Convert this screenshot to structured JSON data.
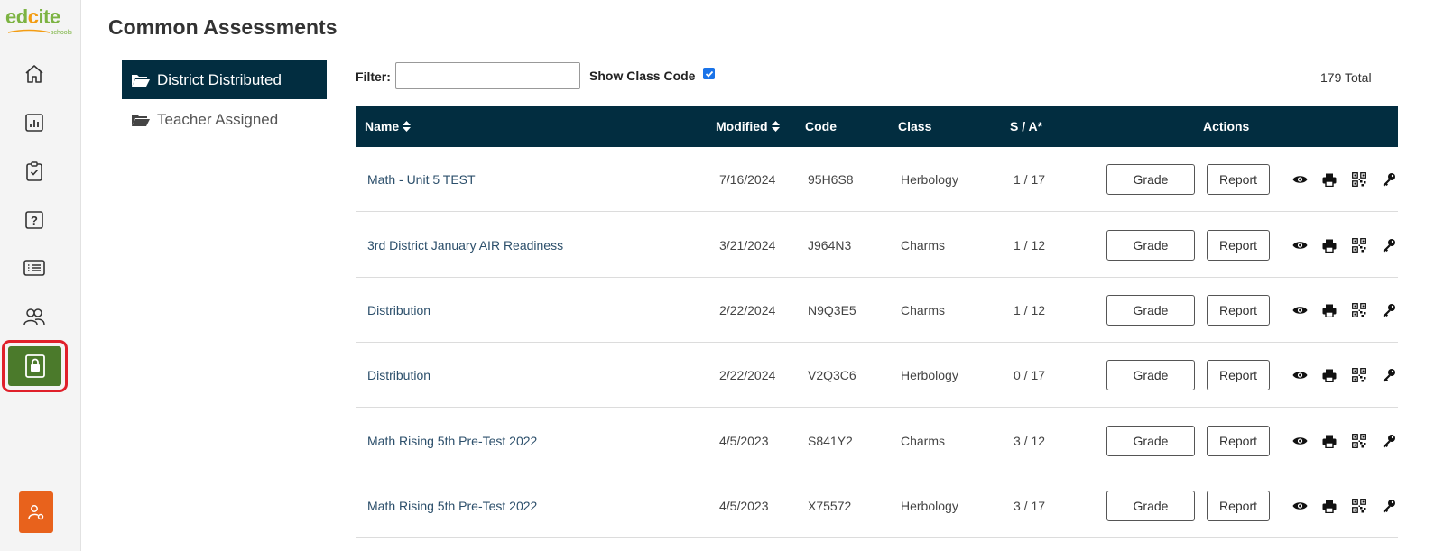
{
  "app": {
    "logo_text": "edcite",
    "logo_sub": "schools",
    "page_title": "Common Assessments"
  },
  "sidebar": {
    "items": [
      {
        "icon": "home-icon"
      },
      {
        "icon": "chart-icon"
      },
      {
        "icon": "clipboard-check-icon"
      },
      {
        "icon": "question-icon"
      },
      {
        "icon": "list-icon"
      },
      {
        "icon": "users-icon"
      },
      {
        "icon": "lock-icon",
        "active": true
      }
    ],
    "user_icon": "user-settings-icon"
  },
  "folders": [
    {
      "label": "District Distributed",
      "active": true
    },
    {
      "label": "Teacher Assigned",
      "active": false
    }
  ],
  "toolbar": {
    "filter_label": "Filter:",
    "filter_value": "",
    "show_class_code_label": "Show Class Code",
    "show_class_code_checked": true,
    "total": "179 Total"
  },
  "table": {
    "headers": {
      "name": "Name",
      "modified": "Modified",
      "code": "Code",
      "class": "Class",
      "sa": "S / A*",
      "actions": "Actions"
    },
    "grade_label": "Grade",
    "report_label": "Report",
    "rows": [
      {
        "name": "Math - Unit 5 TEST",
        "modified": "7/16/2024",
        "code": "95H6S8",
        "class": "Herbology",
        "sa": "1 / 17"
      },
      {
        "name": "3rd District January AIR Readiness",
        "modified": "3/21/2024",
        "code": "J964N3",
        "class": "Charms",
        "sa": "1 / 12"
      },
      {
        "name": "Distribution",
        "modified": "2/22/2024",
        "code": "N9Q3E5",
        "class": "Charms",
        "sa": "1 / 12"
      },
      {
        "name": "Distribution",
        "modified": "2/22/2024",
        "code": "V2Q3C6",
        "class": "Herbology",
        "sa": "0 / 17"
      },
      {
        "name": "Math Rising 5th Pre-Test 2022",
        "modified": "4/5/2023",
        "code": "S841Y2",
        "class": "Charms",
        "sa": "3 / 12"
      },
      {
        "name": "Math Rising 5th Pre-Test 2022",
        "modified": "4/5/2023",
        "code": "X75572",
        "class": "Herbology",
        "sa": "3 / 17"
      }
    ]
  },
  "colors": {
    "header_navy": "#022d40",
    "active_nav_green": "#4b7a2b",
    "highlight_red": "#e0202a",
    "user_button_orange": "#e8621c",
    "link_blue": "#2c4f6b"
  }
}
